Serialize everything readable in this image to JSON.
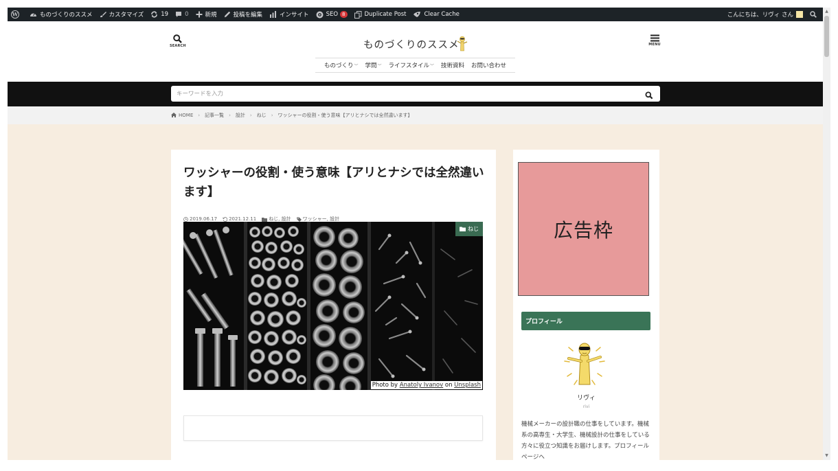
{
  "adminbar": {
    "site_name": "ものづくりのススメ",
    "customize": "カスタマイズ",
    "updates_count": "19",
    "comments_count": "0",
    "new": "新規",
    "edit_post": "投稿を編集",
    "insight": "インサイト",
    "seo": "SEO",
    "seo_badge": "8",
    "duplicate": "Duplicate Post",
    "clear_cache": "Clear Cache",
    "greeting": "こんにちは、リヴィ さん"
  },
  "header": {
    "search_label": "SEARCH",
    "menu_label": "MENU",
    "logo_text": "ものづくりのススメ"
  },
  "nav": [
    {
      "label": "ものづくり",
      "has_sub": true
    },
    {
      "label": "学問",
      "has_sub": true
    },
    {
      "label": "ライフスタイル",
      "has_sub": true
    },
    {
      "label": "技術資料",
      "has_sub": false
    },
    {
      "label": "お問い合わせ",
      "has_sub": false
    }
  ],
  "search": {
    "placeholder": "キーワードを入力"
  },
  "breadcrumb": [
    "HOME",
    "記事一覧",
    "設計",
    "ねじ",
    "ワッシャーの役割・使う意味【アリとナシでは全然違います】"
  ],
  "article": {
    "title": "ワッシャーの役割・使う意味【アリとナシでは全然違います】",
    "published": "2019.06.17",
    "updated": "2021.12.11",
    "categories": "ねじ, 設計",
    "tags": "ワッシャー, 設計",
    "category_label": "ねじ",
    "credit_prefix": "Photo by",
    "credit_author": "Anatoly Ivanov",
    "credit_on": "on",
    "credit_site": "Unsplash"
  },
  "sidebar": {
    "ad_text": "広告枠",
    "profile_title": "プロフィール",
    "profile_name": "リヴィ",
    "profile_sub": "rivi",
    "profile_desc": "機械メーカーの設計職の仕事をしています。機械系の高専生・大学生、機械設計の仕事をしている方々に役立つ知識をお届けします。プロフィールページへ"
  },
  "colors": {
    "admin_bar": "#1d2327",
    "accent_green": "#3a7457",
    "page_bg": "#f7ede0",
    "ad_bg": "#e79a9a",
    "seo_badge": "#d63638"
  }
}
